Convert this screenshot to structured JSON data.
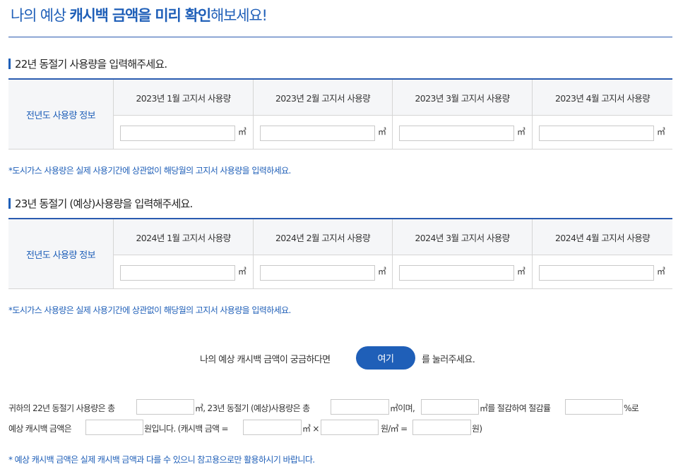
{
  "header": {
    "title_part1": "나의 예상 ",
    "title_bold1": "캐시백 금액을 미리 확인",
    "title_part2": "해보세요!"
  },
  "sections": [
    {
      "title": "22년 동절기 사용량을 입력해주세요.",
      "row_label": "전년도 사용량 정보",
      "columns": [
        "2023년 1월 고지서 사용량",
        "2023년 2월 고지서 사용량",
        "2023년 3월 고지서 사용량",
        "2023년 4월 고지서 사용량"
      ],
      "unit": "㎥",
      "note": "*도시가스 사용량은 실제 사용기간에 상관없이 해당월의 고지서 사용량을 입력하세요."
    },
    {
      "title": "23년 동절기 (예상)사용량을 입력해주세요.",
      "row_label": "전년도 사용량 정보",
      "columns": [
        "2024년 1월 고지서 사용량",
        "2024년 2월 고지서 사용량",
        "2024년 3월 고지서 사용량",
        "2024년 4월 고지서 사용량"
      ],
      "unit": "㎥",
      "note": "*도시가스 사용량은 실제 사용기간에 상관없이 해당월의 고지서 사용량을 입력하세요."
    }
  ],
  "cta": {
    "pre": "나의 예상 캐시백 금액이 궁금하다면",
    "button": "여기",
    "post": "를 눌러주세요."
  },
  "result": {
    "line1": {
      "t1": "귀하의 22년 동절기 사용량은 총",
      "t2": "㎥, 23년 동절기 (예상)사용량은 총",
      "t3": "㎥이며,",
      "t4": "㎥를 절감하여 절감률",
      "t5": "%로"
    },
    "line2": {
      "t1": "예상 캐시백 금액은",
      "t2": "원입니다. (캐시백 금액 =",
      "t3": "㎥ ×",
      "t4": "원/㎥ =",
      "t5": "원)"
    }
  },
  "footnote": "* 예상 캐시백 금액은 실제 캐시백 금액과 다를 수 있으니 참고용으로만 활용하시기 바랍니다."
}
